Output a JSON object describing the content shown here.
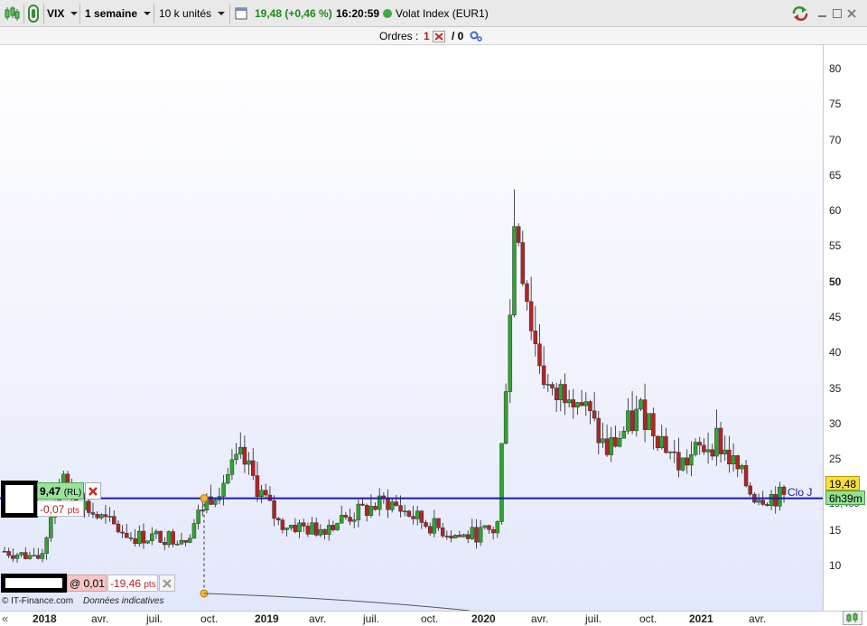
{
  "toolbar": {
    "symbol": "VIX",
    "period": "1 semaine",
    "units": "10 k unités",
    "price_change": "19,48 (+0,46 %)",
    "time": "16:20:59",
    "instrument": "Volat Index (EUR1)"
  },
  "orders": {
    "label": "Ordres :",
    "count_a": "1",
    "count_b": "/ 0"
  },
  "price_axis": {
    "ticks": [
      "80",
      "75",
      "70",
      "65",
      "60",
      "55",
      "50",
      "45",
      "40",
      "35",
      "30",
      "25",
      "20",
      "15",
      "10"
    ],
    "last_price": "19,48",
    "countdown": "6h39m",
    "line_price": "19,460"
  },
  "time_axis": {
    "ticks": [
      {
        "label": "2018",
        "year": true
      },
      {
        "label": "avr.",
        "year": false
      },
      {
        "label": "juil.",
        "year": false
      },
      {
        "label": "oct.",
        "year": false
      },
      {
        "label": "2019",
        "year": true
      },
      {
        "label": "avr.",
        "year": false
      },
      {
        "label": "juil.",
        "year": false
      },
      {
        "label": "oct.",
        "year": false
      },
      {
        "label": "2020",
        "year": true
      },
      {
        "label": "avr.",
        "year": false
      },
      {
        "label": "juil.",
        "year": false
      },
      {
        "label": "oct.",
        "year": false
      },
      {
        "label": "2021",
        "year": true
      },
      {
        "label": "avr.",
        "year": false
      }
    ]
  },
  "order_panel": {
    "price": "9,47",
    "type": "(RL)",
    "diff": "-0,07",
    "diff_unit": "pts",
    "horizontal_label": "Clo J"
  },
  "lower_panel": {
    "at_price": "@ 0,01",
    "diff": "-19,46",
    "diff_unit": "pts"
  },
  "footer": {
    "copyright": "© IT-Finance.com",
    "note": "Données indicatives"
  },
  "colors": {
    "up": "#2fa52f",
    "down": "#b52323",
    "line": "#1c1ca0",
    "accent_green": "#1d8a1d"
  },
  "chart_data": {
    "type": "candlestick",
    "ylim": [
      5,
      82
    ],
    "x_start": "2017-11",
    "x_end": "2021-06",
    "horizontal_line": 19.46,
    "anchors": [
      {
        "date": "2017-11",
        "price": 12
      },
      {
        "date": "2018-01",
        "price": 11
      },
      {
        "date": "2018-02",
        "price": 22
      },
      {
        "date": "2018-04",
        "price": 17
      },
      {
        "date": "2018-06",
        "price": 14
      },
      {
        "date": "2018-09",
        "price": 14
      },
      {
        "date": "2018-10",
        "price": 19
      },
      {
        "date": "2018-12",
        "price": 25
      },
      {
        "date": "2019-02",
        "price": 16
      },
      {
        "date": "2019-04",
        "price": 15
      },
      {
        "date": "2019-06",
        "price": 17
      },
      {
        "date": "2019-08",
        "price": 19
      },
      {
        "date": "2019-10",
        "price": 16
      },
      {
        "date": "2019-12",
        "price": 14
      },
      {
        "date": "2020-02",
        "price": 15
      },
      {
        "date": "2020-03",
        "price": 60
      },
      {
        "date": "2020-04",
        "price": 42
      },
      {
        "date": "2020-05",
        "price": 33
      },
      {
        "date": "2020-06",
        "price": 36
      },
      {
        "date": "2020-08",
        "price": 26
      },
      {
        "date": "2020-10",
        "price": 32
      },
      {
        "date": "2020-12",
        "price": 24
      },
      {
        "date": "2021-02",
        "price": 28
      },
      {
        "date": "2021-04",
        "price": 20
      },
      {
        "date": "2021-06",
        "price": 19.5
      }
    ],
    "ohlc_sample_last": {
      "open": 21.8,
      "high": 23.2,
      "low": 18.9,
      "close": 19.48
    }
  }
}
